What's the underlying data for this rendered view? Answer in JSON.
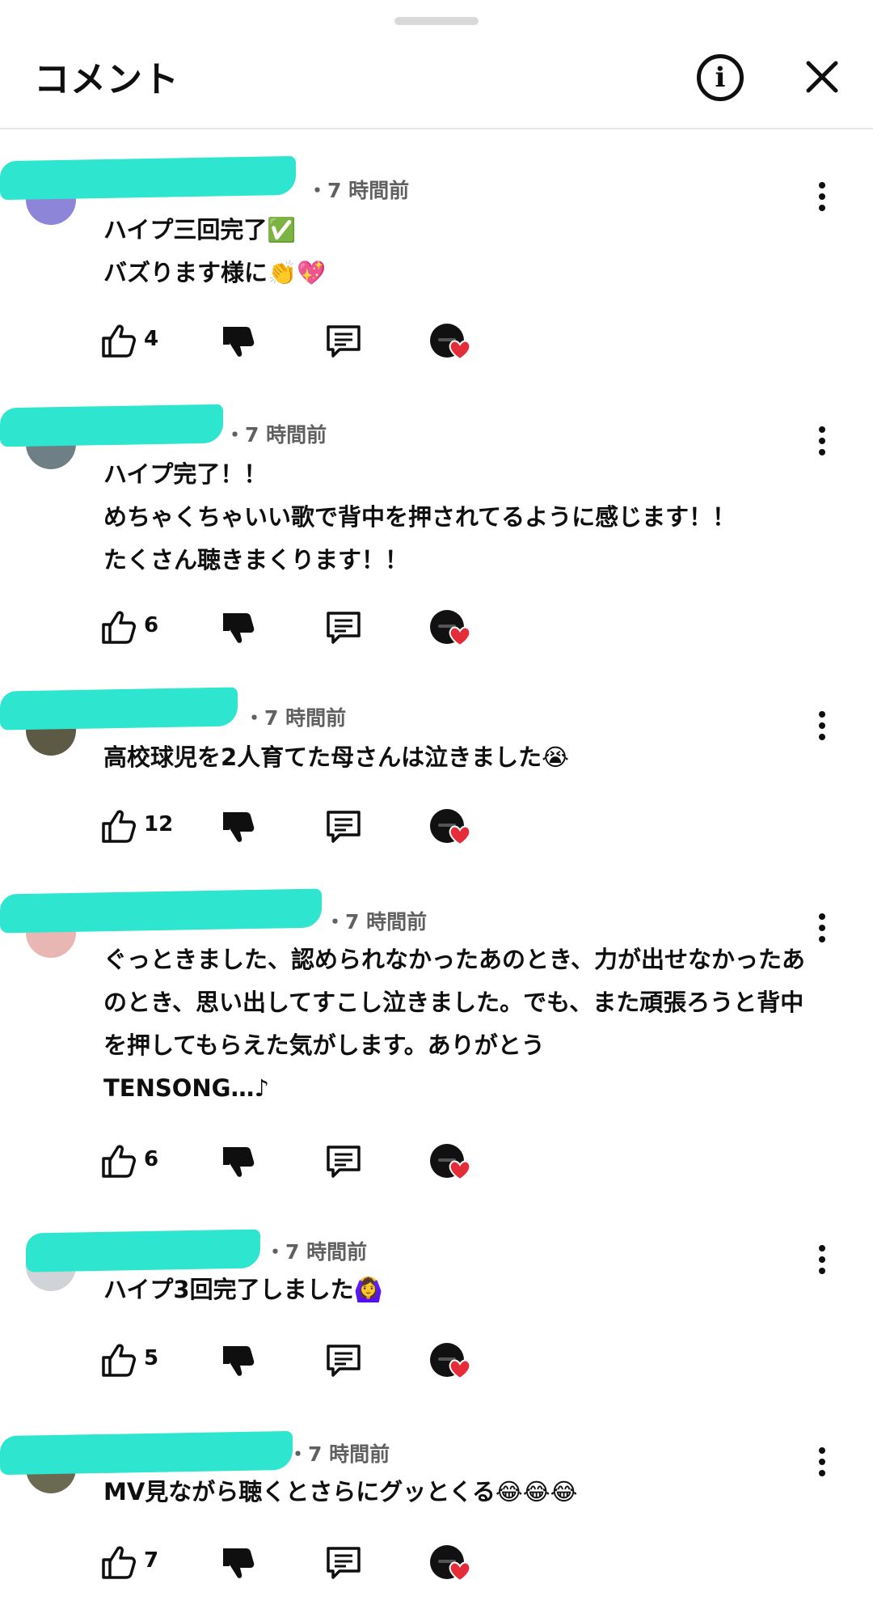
{
  "header": {
    "title": "コメント",
    "info_icon": "info-icon",
    "close_icon": "close-icon"
  },
  "colors": {
    "redaction": "#2ee6cf",
    "heart": "#e52d3a",
    "meta_text": "#606060"
  },
  "comments": [
    {
      "meta": "・7 時間前",
      "text": "ハイプ三回完了✅\nバズります様に👏💖",
      "likes": "4"
    },
    {
      "meta": "・7 時間前",
      "text": "ハイプ完了！！\nめちゃくちゃいい歌で背中を押されてるように感じます！！\nたくさん聴きまくります！！",
      "likes": "6"
    },
    {
      "meta": "・7 時間前",
      "text": "高校球児を2人育てた母さんは泣きました😭",
      "likes": "12"
    },
    {
      "meta": "・7 時間前",
      "text": "ぐっときました、認められなかったあのとき、力が出せなかったあのとき、思い出してすこし泣きました。でも、また頑張ろうと背中を押してもらえた気がします。ありがとう\nTENSONG…♪",
      "likes": "6"
    },
    {
      "meta": "・7 時間前",
      "text": "ハイプ3回完了しました🙆‍♀️",
      "likes": "5"
    },
    {
      "meta": "・7 時間前",
      "text": "MV見ながら聴くとさらにグッとくる😂😂😂",
      "likes": "7"
    }
  ]
}
